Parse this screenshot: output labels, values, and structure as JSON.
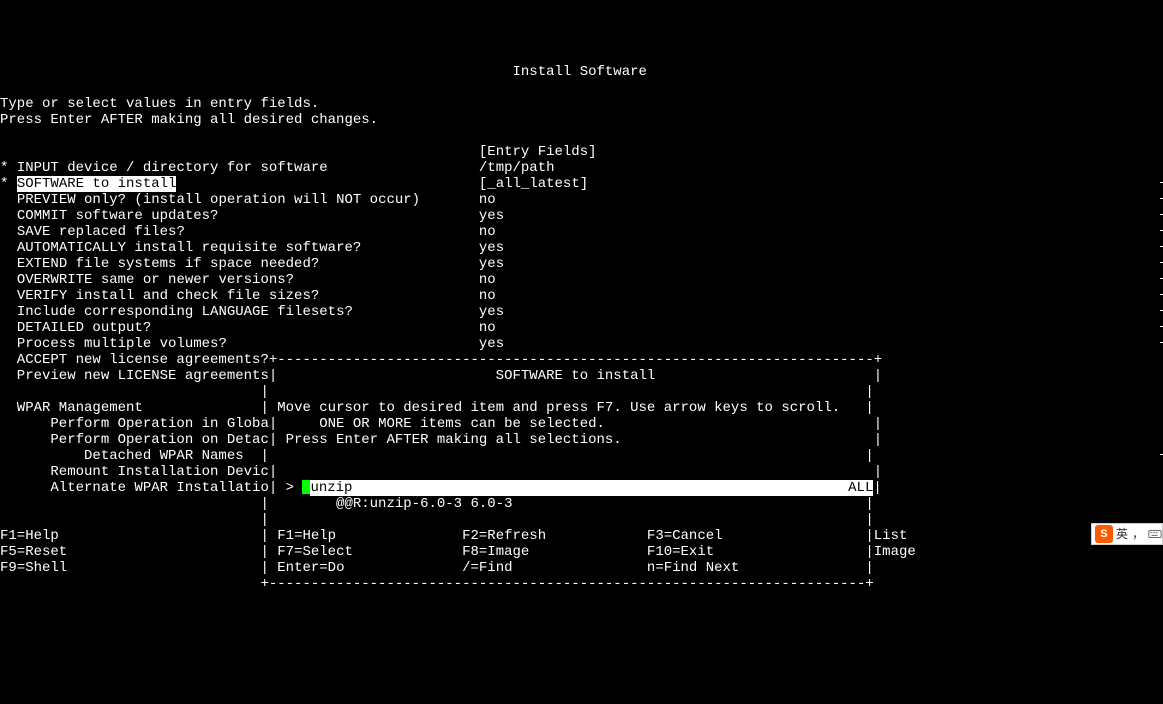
{
  "title": "Install Software",
  "instr1": "Type or select values in entry fields.",
  "instr2": "Press Enter AFTER making all desired changes.",
  "entry_fields_header": "[Entry Fields]",
  "fields": [
    {
      "marker": "*",
      "label": "INPUT device / directory for software",
      "value": "/tmp/path",
      "plus": ""
    },
    {
      "marker": "*",
      "label": "SOFTWARE to install",
      "value": "[_all_latest]",
      "plus": "+",
      "selected": true
    },
    {
      "marker": "",
      "label": "PREVIEW only? (install operation will NOT occur)",
      "value": "no",
      "plus": "+"
    },
    {
      "marker": "",
      "label": "COMMIT software updates?",
      "value": "yes",
      "plus": "+"
    },
    {
      "marker": "",
      "label": "SAVE replaced files?",
      "value": "no",
      "plus": "+"
    },
    {
      "marker": "",
      "label": "AUTOMATICALLY install requisite software?",
      "value": "yes",
      "plus": "+"
    },
    {
      "marker": "",
      "label": "EXTEND file systems if space needed?",
      "value": "yes",
      "plus": "+"
    },
    {
      "marker": "",
      "label": "OVERWRITE same or newer versions?",
      "value": "no",
      "plus": "+"
    },
    {
      "marker": "",
      "label": "VERIFY install and check file sizes?",
      "value": "no",
      "plus": "+"
    },
    {
      "marker": "",
      "label": "Include corresponding LANGUAGE filesets?",
      "value": "yes",
      "plus": "+"
    },
    {
      "marker": "",
      "label": "DETAILED output?",
      "value": "no",
      "plus": "+"
    },
    {
      "marker": "",
      "label": "Process multiple volumes?",
      "value": "yes",
      "plus": "+"
    }
  ],
  "lower_rows": [
    {
      "label": "ACCEPT new license agreements?",
      "plus": "+"
    },
    {
      "label": "Preview new LICENSE agreements",
      "plus": "+"
    },
    {
      "label": "",
      "plus": ""
    },
    {
      "label": "WPAR Management",
      "plus": ""
    },
    {
      "label": "    Perform Operation in Globa",
      "plus": "+"
    },
    {
      "label": "    Perform Operation on Detac",
      "plus": "+"
    },
    {
      "label": "        Detached WPAR Names",
      "plus": "+"
    },
    {
      "label": "    Remount Installation Devic",
      "plus": "+"
    },
    {
      "label": "    Alternate WPAR Installatio",
      "plus": ""
    }
  ],
  "popup": {
    "title": "SOFTWARE to install",
    "line1": "Move cursor to desired item and press F7. Use arrow keys to scroll.",
    "line2": "    ONE OR MORE items can be selected.",
    "line3": "Press Enter AFTER making all selections.",
    "item_marker": ">",
    "item_name": "unzip",
    "item_right": "ALL",
    "item_detail": "    @@R:unzip-6.0-3 6.0-3",
    "fkeys": [
      {
        "c1": "F1=Help",
        "c2": "F2=Refresh",
        "c3": "F3=Cancel"
      },
      {
        "c1": "F7=Select",
        "c2": "F8=Image",
        "c3": "F10=Exit"
      },
      {
        "c1": "Enter=Do",
        "c2": "/=Find",
        "c3": "n=Find Next"
      }
    ]
  },
  "main_fkeys": [
    {
      "k": "F1=Help",
      "side": "List"
    },
    {
      "k": "F5=Reset",
      "side": "Image"
    },
    {
      "k": "F9=Shell",
      "side": ""
    }
  ],
  "ime": {
    "char": "英",
    "comma": "，"
  }
}
